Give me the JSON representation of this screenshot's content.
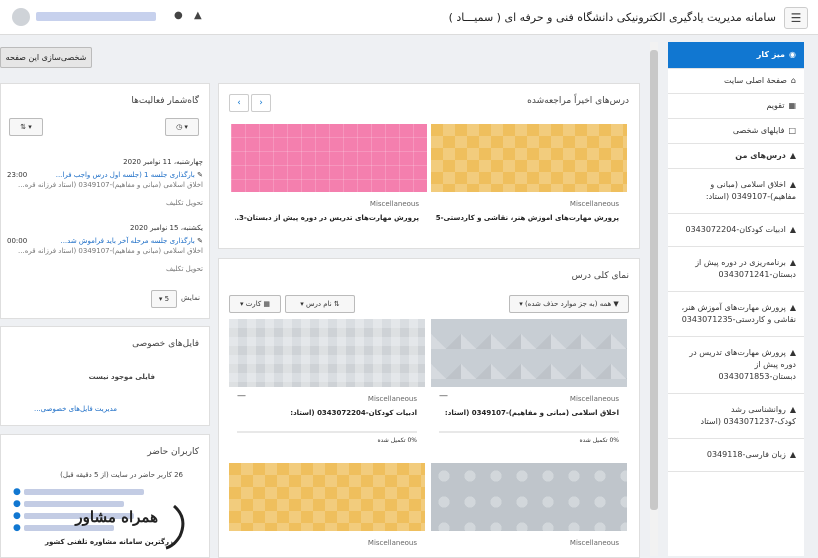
{
  "header": {
    "site_title": "سامانه مدیریت یادگیری الکترونیکی دانشگاه فنی و حرفه ای ( سمیـــاد )",
    "menu_icon": "hamburger-icon",
    "notifications_icon": "bell-icon",
    "messages_icon": "chat-icon"
  },
  "drawer": {
    "items": [
      {
        "label": "میز کار",
        "icon": "dashboard-icon",
        "active": true
      },
      {
        "label": "صفحهٔ اصلی سایت",
        "icon": "home-icon"
      },
      {
        "label": "تقویم",
        "icon": "calendar-icon"
      },
      {
        "label": "فایلهای شخصی",
        "icon": "file-icon"
      },
      {
        "label": "درس‌های من",
        "icon": "graduation-cap-icon"
      },
      {
        "label": "اخلاق اسلامی (مبانی و مفاهیم)-0349107 (استاد:",
        "icon": "graduation-cap-icon"
      },
      {
        "label": "ادبیات کودکان-0343072204",
        "icon": "graduation-cap-icon"
      },
      {
        "label": "برنامه‌ریزی در دوره پیش از دبستان-0343071241",
        "icon": "graduation-cap-icon"
      },
      {
        "label": "پرورش مهارت‌های آموزش هنر، نقاشی و کاردستی-0343071235",
        "icon": "graduation-cap-icon"
      },
      {
        "label": "پرورش مهارت‌های تدریس در دوره پیش از دبستان-0343071853",
        "icon": "graduation-cap-icon"
      },
      {
        "label": "روانشناسی رشد کودک-0343071237 (استاد",
        "icon": "graduation-cap-icon"
      },
      {
        "label": "زبان فارسی-0349118",
        "icon": "graduation-cap-icon"
      }
    ]
  },
  "customize_button": "شخصی‌سازی این صفحه",
  "recent_courses": {
    "title": "درس‌های اخیراً مراجعه‌شده",
    "prev": "‹",
    "next": "›",
    "courses": [
      {
        "category": "Miscellaneous",
        "name": "پرورش مهارت‌های آموزش هنر، نقاشی و کاردستی-5..."
      },
      {
        "category": "Miscellaneous",
        "name": "پرورش مهارت‌های تدریس در دوره پیش از دبستان-3..."
      }
    ]
  },
  "course_overview": {
    "title": "نمای کلی درس",
    "filter_label": "همه (به جز موارد حذف شده)",
    "sort_label": "نام درس",
    "view_label": "کارت",
    "courses": [
      {
        "category": "Miscellaneous",
        "name": "اخلاق اسلامی (مبانی و مفاهیم)-0349107 (استاد:",
        "progress": "0% تکمیل شده"
      },
      {
        "category": "Miscellaneous",
        "name": "ادبیات کودکان-0343072204 (استاد:",
        "progress": "0% تکمیل شده"
      },
      {
        "category": "Miscellaneous",
        "name": ""
      },
      {
        "category": "Miscellaneous",
        "name": ""
      }
    ]
  },
  "timeline": {
    "title": "گاه‌شمار فعالیت‌ها",
    "events": [
      {
        "date": "چهارشنبه، 11 نوامبر 2020",
        "title": "بارگذاری جلسه 1 (جلسه اول درس واجب فرا...",
        "course": "اخلاق اسلامی (مبانی و مفاهیم)-0349107 (استاد فرزانه قره...",
        "time": "23:00",
        "action": "تحویل تکلیف"
      },
      {
        "date": "یکشنبه، 15 نوامبر 2020",
        "title": "بارگذاری جلسه مرحله آخر باید فراموش شد...",
        "course": "اخلاق اسلامی (مبانی و مفاهیم)-0349107 (استاد فرزانه قره...",
        "time": "00:00",
        "action": "تحویل تکلیف"
      }
    ],
    "show_label": "نمایش",
    "show_count": "5"
  },
  "private_files": {
    "title": "فایل‌های خصوصی",
    "empty": "فایلی موجود نیست",
    "manage_link": "مدیریت فایل‌های خصوصی..."
  },
  "online_users": {
    "title": "کاربران حاضر",
    "summary": "26 کاربر حاضر در سایت (از 5 دقیقه قبل)"
  },
  "watermark": {
    "name": "همراه مشاور",
    "tagline": "بزرگترین سامانه مشاوره تلفنی کشور"
  }
}
